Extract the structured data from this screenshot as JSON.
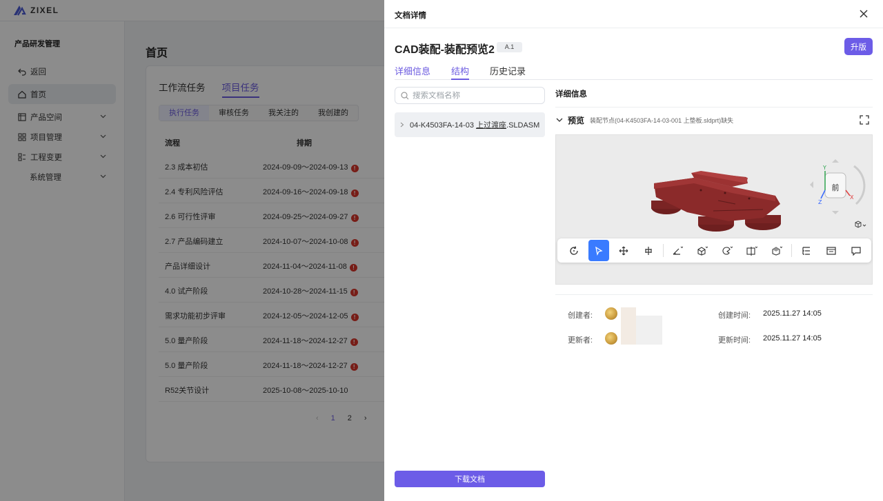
{
  "app": {
    "brand": "ZIXEL"
  },
  "sidebar": {
    "title": "产品研发管理",
    "items": [
      {
        "label": "返回",
        "icon": "back-arrow-icon"
      },
      {
        "label": "首页",
        "icon": "home-icon",
        "active": true
      },
      {
        "label": "产品空间",
        "icon": "grid-icon",
        "expandable": true
      },
      {
        "label": "项目管理",
        "icon": "apps-icon",
        "expandable": true
      },
      {
        "label": "工程变更",
        "icon": "list-icon",
        "expandable": true
      },
      {
        "label": "系统管理",
        "icon": "",
        "expandable": true
      }
    ]
  },
  "main": {
    "title": "首页",
    "tabs": [
      "工作流任务",
      "项目任务"
    ],
    "active_tab": 1,
    "subtabs": [
      "执行任务",
      "审核任务",
      "我关注的",
      "我创建的"
    ],
    "columns": [
      "流程",
      "排期"
    ],
    "rows": [
      {
        "name": "2.3 成本初估",
        "schedule": "2024-09-09～2024-09-13",
        "warn": true
      },
      {
        "name": "2.4 专利风险评估",
        "schedule": "2024-09-16～2024-09-18",
        "warn": true
      },
      {
        "name": "2.6 可行性评审",
        "schedule": "2024-09-25～2024-09-27",
        "warn": true
      },
      {
        "name": "2.7 产品编码建立",
        "schedule": "2024-10-07～2024-10-08",
        "warn": true
      },
      {
        "name": "产品详细设计",
        "schedule": "2024-11-04～2024-11-08",
        "warn": true
      },
      {
        "name": "4.0 试产阶段",
        "schedule": "2024-10-28～2024-11-15",
        "warn": true
      },
      {
        "name": "需求功能初步评审",
        "schedule": "2024-12-05～2024-12-05",
        "warn": true
      },
      {
        "name": "5.0 量产阶段",
        "schedule": "2024-11-18～2024-12-27",
        "warn": true
      },
      {
        "name": "5.0 量产阶段",
        "schedule": "2024-11-18～2024-12-27",
        "warn": true
      },
      {
        "name": "R52关节设计",
        "schedule": "2025-10-08～2025-10-10",
        "warn": false
      }
    ],
    "warn_glyph": "!",
    "pager": {
      "pages": [
        "1",
        "2"
      ],
      "current": "1"
    }
  },
  "drawer": {
    "title": "文档详情",
    "doc_title": "CAD装配-装配预览2",
    "version": "A.1",
    "upgrade_label": "升版",
    "tabs": [
      "详细信息",
      "结构",
      "历史记录"
    ],
    "active_tab": 1,
    "search_placeholder": "搜索文档名称",
    "tree_item": {
      "prefix": "04-K4503FA-14-03",
      "name": "上过渡座",
      "ext": ".SLDASM"
    },
    "download_label": "下载文档",
    "detail_title": "详细信息",
    "preview_label": "预览",
    "preview_note": "装配节点(04-K4503FA-14-03-001 上垫板.sldprt)缺失",
    "view_cube_label": "前",
    "axes": {
      "x": "X",
      "y": "Y",
      "z": "Z"
    },
    "creator_label": "创建者:",
    "updater_label": "更新者:",
    "created_time_label": "创建时间:",
    "updated_time_label": "更新时间:",
    "created_time": "2025.11.27 14:05",
    "updated_time": "2025.11.27 14:05",
    "colors": {
      "accent": "#6c5ce7",
      "tool_active": "#3a7bff",
      "model": "#8b2a2a"
    }
  }
}
